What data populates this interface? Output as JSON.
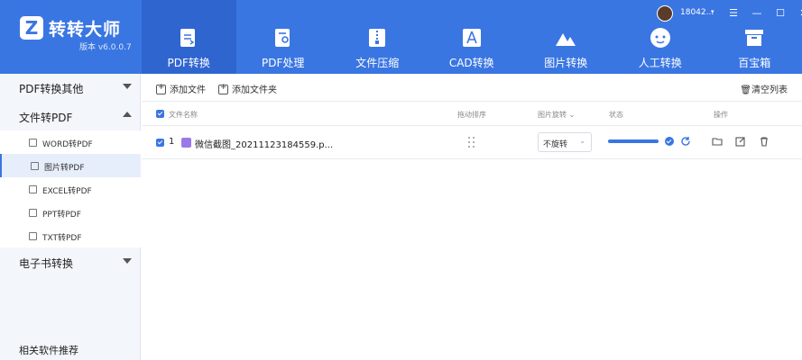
{
  "app": {
    "title": "转转大师",
    "version": "版本 v6.0.0.7",
    "brand_color": "#3a76e2"
  },
  "nav": [
    {
      "label": "PDF转换",
      "icon": "pdf-convert-icon",
      "active": true
    },
    {
      "label": "PDF处理",
      "icon": "pdf-process-icon",
      "active": false
    },
    {
      "label": "文件压缩",
      "icon": "zip-icon",
      "active": false
    },
    {
      "label": "CAD转换",
      "icon": "cad-icon",
      "active": false
    },
    {
      "label": "图片转换",
      "icon": "image-convert-icon",
      "active": false
    },
    {
      "label": "人工转换",
      "icon": "manual-service-icon",
      "active": false
    },
    {
      "label": "百宝箱",
      "icon": "toolbox-icon",
      "active": false
    }
  ],
  "user": {
    "name": "18042...",
    "caret": "▾"
  },
  "window_controls": [
    "☰",
    "—",
    "☐",
    "✕"
  ],
  "sidebar": {
    "cat1": "PDF转换其他",
    "cat2": "文件转PDF",
    "sub": [
      "WORD转PDF",
      "图片转PDF",
      "EXCEL转PDF",
      "PPT转PDF",
      "TXT转PDF"
    ],
    "active_sub": 1,
    "cat3": "电子书转换",
    "related": "相关软件推荐"
  },
  "toolbar": {
    "add_file": "添加文件",
    "add_folder": "添加文件夹",
    "clear_list": "清空列表"
  },
  "table": {
    "headers": {
      "name": "文件名称",
      "drag": "拖动排序",
      "rotate": "图片旋转",
      "status": "状态",
      "action": "操作"
    },
    "rows": [
      {
        "index": "1",
        "file_name": "微信截图_20211123184559.p...",
        "rotation": "不旋转",
        "progress_percent": 100
      }
    ]
  }
}
